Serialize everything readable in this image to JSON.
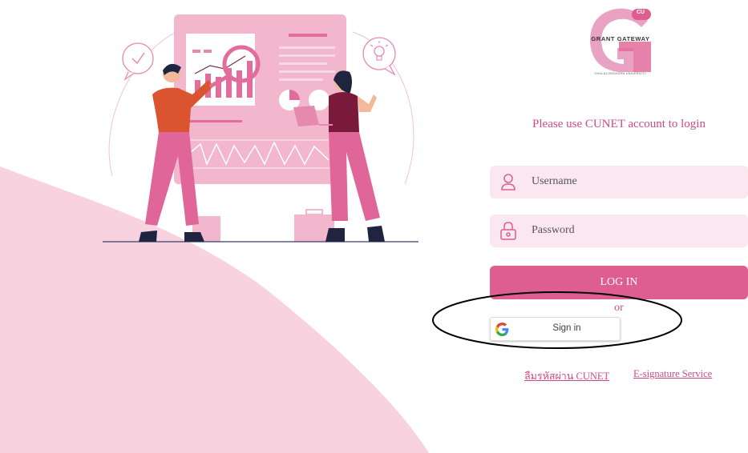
{
  "colors": {
    "accent": "#dd5e8f",
    "accent_text": "#cf4a84",
    "field_bg": "#fbe7ef",
    "blob": "#f9d2e0"
  },
  "logo": {
    "brand": "GRANT GATEWAY",
    "badge": "CU",
    "university": "CHULALONGKORN UNIVERSITY"
  },
  "login": {
    "instruction": "Please use CUNET account to login",
    "username_label": "Username",
    "password_label": "Password",
    "login_button": "LOG IN",
    "or_text": "or",
    "google_button": "Sign in"
  },
  "icons": {
    "username": "user-icon",
    "password": "lock-icon",
    "google": "google-icon",
    "logo": "grant-gateway-logo"
  },
  "links": {
    "forgot_password": "ลืมรหัสผ่าน CUNET",
    "esignature": "E-signature Service"
  }
}
